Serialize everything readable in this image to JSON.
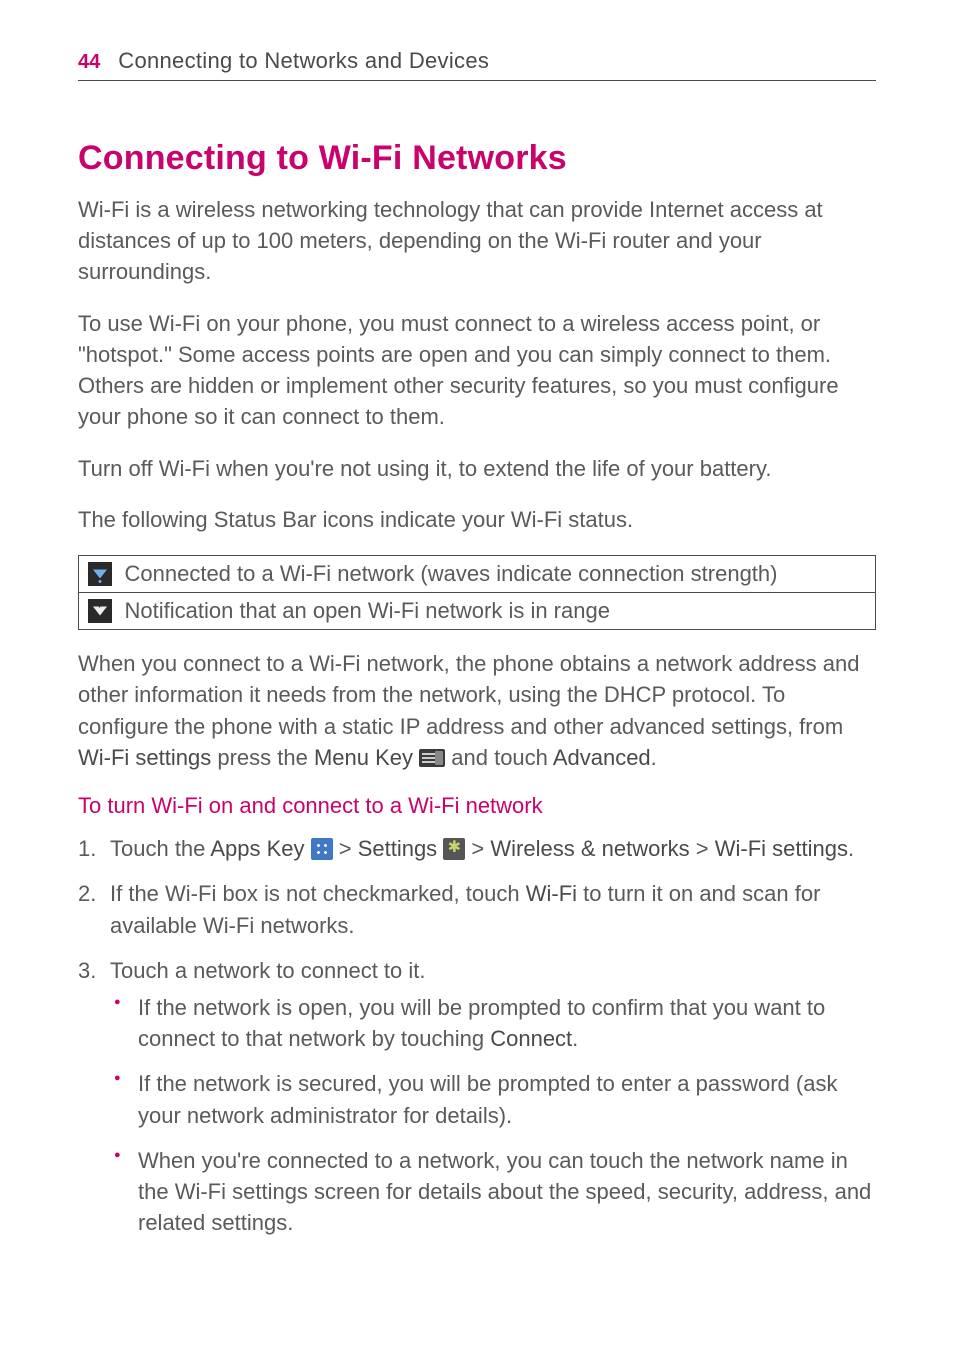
{
  "header": {
    "page_number": "44",
    "section_title": "Connecting to Networks and Devices"
  },
  "h1": "Connecting to Wi-Fi Networks",
  "p1": "Wi-Fi is a wireless networking technology that can provide Internet access at distances of up to 100 meters, depending on the Wi-Fi router and your surroundings.",
  "p2": "To use Wi-Fi on your phone, you must connect to a wireless access point, or \"hotspot.\" Some access points are open and you can simply connect to them. Others are hidden or implement other security features, so you must configure your phone so it can connect to them.",
  "p3": "Turn off Wi-Fi when you're not using it, to extend the life of your battery.",
  "p4": "The following Status Bar icons indicate your Wi-Fi status.",
  "table": {
    "row1": "Connected to a Wi-Fi network (waves indicate connection strength)",
    "row2": "Notification that an open Wi-Fi network is in range"
  },
  "p5_pre": "When you connect to a Wi-Fi network, the phone obtains a network address and other information it needs from the network, using the DHCP protocol. To configure the phone with a static IP address and other advanced settings, from ",
  "p5_b1": "Wi-Fi settings",
  "p5_mid1": " press the ",
  "p5_b2": "Menu Key",
  "p5_mid2": " ",
  "p5_mid3": " and touch ",
  "p5_b3": "Advanced",
  "p5_end": ".",
  "h2": "To turn Wi-Fi on and connect to a Wi-Fi network",
  "steps": {
    "s1_pre": "Touch the ",
    "s1_b1": "Apps Key",
    "s1_gt1": " > ",
    "s1_b2": "Settings",
    "s1_gt2": " > ",
    "s1_b3": "Wireless & networks",
    "s1_gt3": " > ",
    "s1_b4": "Wi-Fi settings",
    "s1_end": ".",
    "s2_pre": "If the Wi-Fi box is not checkmarked, touch ",
    "s2_b1": "Wi-Fi",
    "s2_end": " to turn it on and scan for available Wi-Fi networks.",
    "s3": "Touch a network to connect to it.",
    "s3_bullets": {
      "b1_pre": "If the network is open, you will be prompted to confirm that you want to connect to that network by touching ",
      "b1_bold": "Connect",
      "b1_end": ".",
      "b2": "If the network is secured, you will be prompted to enter a password (ask your network administrator for details).",
      "b3": "When you're connected to a network, you can touch the network name in the Wi-Fi settings screen for details about the speed, security, address, and related settings."
    }
  }
}
